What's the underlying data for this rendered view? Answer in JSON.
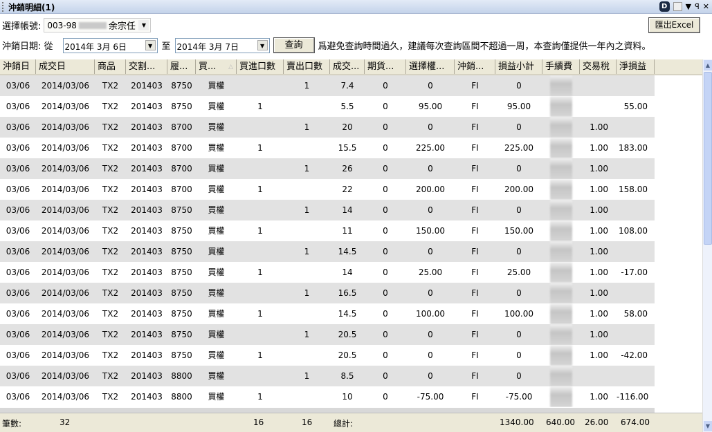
{
  "window": {
    "title": "沖銷明細(1)",
    "d_icon": "D",
    "icons": [
      "window-icon",
      "dropdown-icon",
      "pin-icon",
      "close-icon"
    ]
  },
  "account": {
    "label": "選擇帳號:",
    "prefix": "003-98",
    "name": "余宗任"
  },
  "date": {
    "label": "沖銷日期: 從",
    "from": "2014年  3月  6日",
    "to_label": "至",
    "to": "2014年  3月  7日"
  },
  "query_button": "查詢",
  "notice": "爲避免查詢時間過久，建議每次查詢區間不超過一周，本查詢僅提供一年內之資料。",
  "export_button": "匯出Excel",
  "columns": [
    "沖銷日",
    "成交日",
    "商品",
    "交割...",
    "履...",
    "買...",
    "買進口數",
    "賣出口數",
    "成交...",
    "期貨...",
    "選擇權...",
    "沖銷...",
    "損益小計",
    "手續費",
    "交易稅",
    "淨損益"
  ],
  "rows": [
    [
      "03/06",
      "2014/03/06",
      "TX2",
      "201403",
      "8750",
      "買權",
      "",
      "1",
      "7.4",
      "0",
      "0",
      "FI",
      "0",
      "",
      "",
      ""
    ],
    [
      "03/06",
      "2014/03/06",
      "TX2",
      "201403",
      "8750",
      "買權",
      "1",
      "",
      "5.5",
      "0",
      "95.00",
      "FI",
      "95.00",
      "",
      "",
      "55.00"
    ],
    [
      "03/06",
      "2014/03/06",
      "TX2",
      "201403",
      "8700",
      "買權",
      "",
      "1",
      "20",
      "0",
      "0",
      "FI",
      "0",
      "",
      "1.00",
      ""
    ],
    [
      "03/06",
      "2014/03/06",
      "TX2",
      "201403",
      "8700",
      "買權",
      "1",
      "",
      "15.5",
      "0",
      "225.00",
      "FI",
      "225.00",
      "",
      "1.00",
      "183.00"
    ],
    [
      "03/06",
      "2014/03/06",
      "TX2",
      "201403",
      "8700",
      "買權",
      "",
      "1",
      "26",
      "0",
      "0",
      "FI",
      "0",
      "",
      "1.00",
      ""
    ],
    [
      "03/06",
      "2014/03/06",
      "TX2",
      "201403",
      "8700",
      "買權",
      "1",
      "",
      "22",
      "0",
      "200.00",
      "FI",
      "200.00",
      "",
      "1.00",
      "158.00"
    ],
    [
      "03/06",
      "2014/03/06",
      "TX2",
      "201403",
      "8750",
      "買權",
      "",
      "1",
      "14",
      "0",
      "0",
      "FI",
      "0",
      "",
      "1.00",
      ""
    ],
    [
      "03/06",
      "2014/03/06",
      "TX2",
      "201403",
      "8750",
      "買權",
      "1",
      "",
      "11",
      "0",
      "150.00",
      "FI",
      "150.00",
      "",
      "1.00",
      "108.00"
    ],
    [
      "03/06",
      "2014/03/06",
      "TX2",
      "201403",
      "8750",
      "買權",
      "",
      "1",
      "14.5",
      "0",
      "0",
      "FI",
      "0",
      "",
      "1.00",
      ""
    ],
    [
      "03/06",
      "2014/03/06",
      "TX2",
      "201403",
      "8750",
      "買權",
      "1",
      "",
      "14",
      "0",
      "25.00",
      "FI",
      "25.00",
      "",
      "1.00",
      "-17.00"
    ],
    [
      "03/06",
      "2014/03/06",
      "TX2",
      "201403",
      "8750",
      "買權",
      "",
      "1",
      "16.5",
      "0",
      "0",
      "FI",
      "0",
      "",
      "1.00",
      ""
    ],
    [
      "03/06",
      "2014/03/06",
      "TX2",
      "201403",
      "8750",
      "買權",
      "1",
      "",
      "14.5",
      "0",
      "100.00",
      "FI",
      "100.00",
      "",
      "1.00",
      "58.00"
    ],
    [
      "03/06",
      "2014/03/06",
      "TX2",
      "201403",
      "8750",
      "買權",
      "",
      "1",
      "20.5",
      "0",
      "0",
      "FI",
      "0",
      "",
      "1.00",
      ""
    ],
    [
      "03/06",
      "2014/03/06",
      "TX2",
      "201403",
      "8750",
      "買權",
      "1",
      "",
      "20.5",
      "0",
      "0",
      "FI",
      "0",
      "",
      "1.00",
      "-42.00"
    ],
    [
      "03/06",
      "2014/03/06",
      "TX2",
      "201403",
      "8800",
      "買權",
      "",
      "1",
      "8.5",
      "0",
      "0",
      "FI",
      "0",
      "",
      "",
      ""
    ],
    [
      "03/06",
      "2014/03/06",
      "TX2",
      "201403",
      "8800",
      "買權",
      "1",
      "",
      "10",
      "0",
      "-75.00",
      "FI",
      "-75.00",
      "",
      "1.00",
      "-116.00"
    ]
  ],
  "footer": {
    "count_label": "筆數:",
    "count": "32",
    "buy_total": "16",
    "sell_total": "16",
    "total_label": "總計:",
    "pnl": "1340.00",
    "fee": "640.00",
    "tax": "26.00",
    "net": "674.00"
  }
}
